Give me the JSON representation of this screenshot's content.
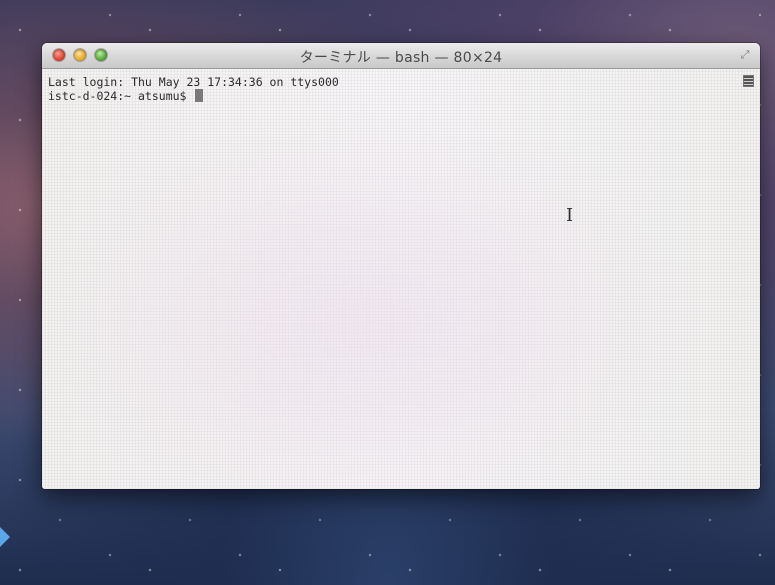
{
  "window": {
    "title": "ターミナル — bash — 80×24"
  },
  "terminal": {
    "lines": [
      "Last login: Thu May 23 17:34:36 on ttys000",
      "istc-d-024:~ atsumu$ "
    ]
  },
  "icons": {
    "close": "close-button",
    "minimize": "minimize-button",
    "zoom": "zoom-button",
    "fullscreen": "fullscreen-icon",
    "scroll_marker": "scroll-marker-icon",
    "text_cursor": "ibeam-cursor-icon"
  },
  "colors": {
    "close": "#d8392c",
    "minimize": "#e1a021",
    "zoom": "#4c9e2e",
    "terminal_text": "#2b2b2b",
    "terminal_bg": "#f4f2f1"
  }
}
